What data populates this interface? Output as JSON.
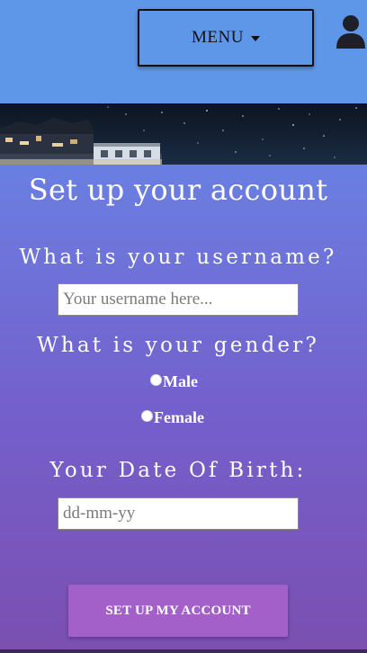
{
  "header": {
    "menu_label": "MENU",
    "icons": {
      "menu_caret": "caret-down-icon",
      "user": "user-icon"
    }
  },
  "form": {
    "title": "Set up your account",
    "username": {
      "question": "What is your username?",
      "value": "",
      "placeholder": "Your username here..."
    },
    "gender": {
      "question": "What is your gender?",
      "options": [
        "Male",
        "Female"
      ]
    },
    "dob": {
      "question": "Your Date Of Birth:",
      "value": "",
      "placeholder": "dd-mm-yy"
    },
    "submit_label": "SET UP MY ACCOUNT"
  },
  "colors": {
    "header_bg": "#5f97e8",
    "gradient_top": "#6a7fe2",
    "gradient_bottom": "#7b4fb0",
    "submit_bg": "#a460c9"
  }
}
